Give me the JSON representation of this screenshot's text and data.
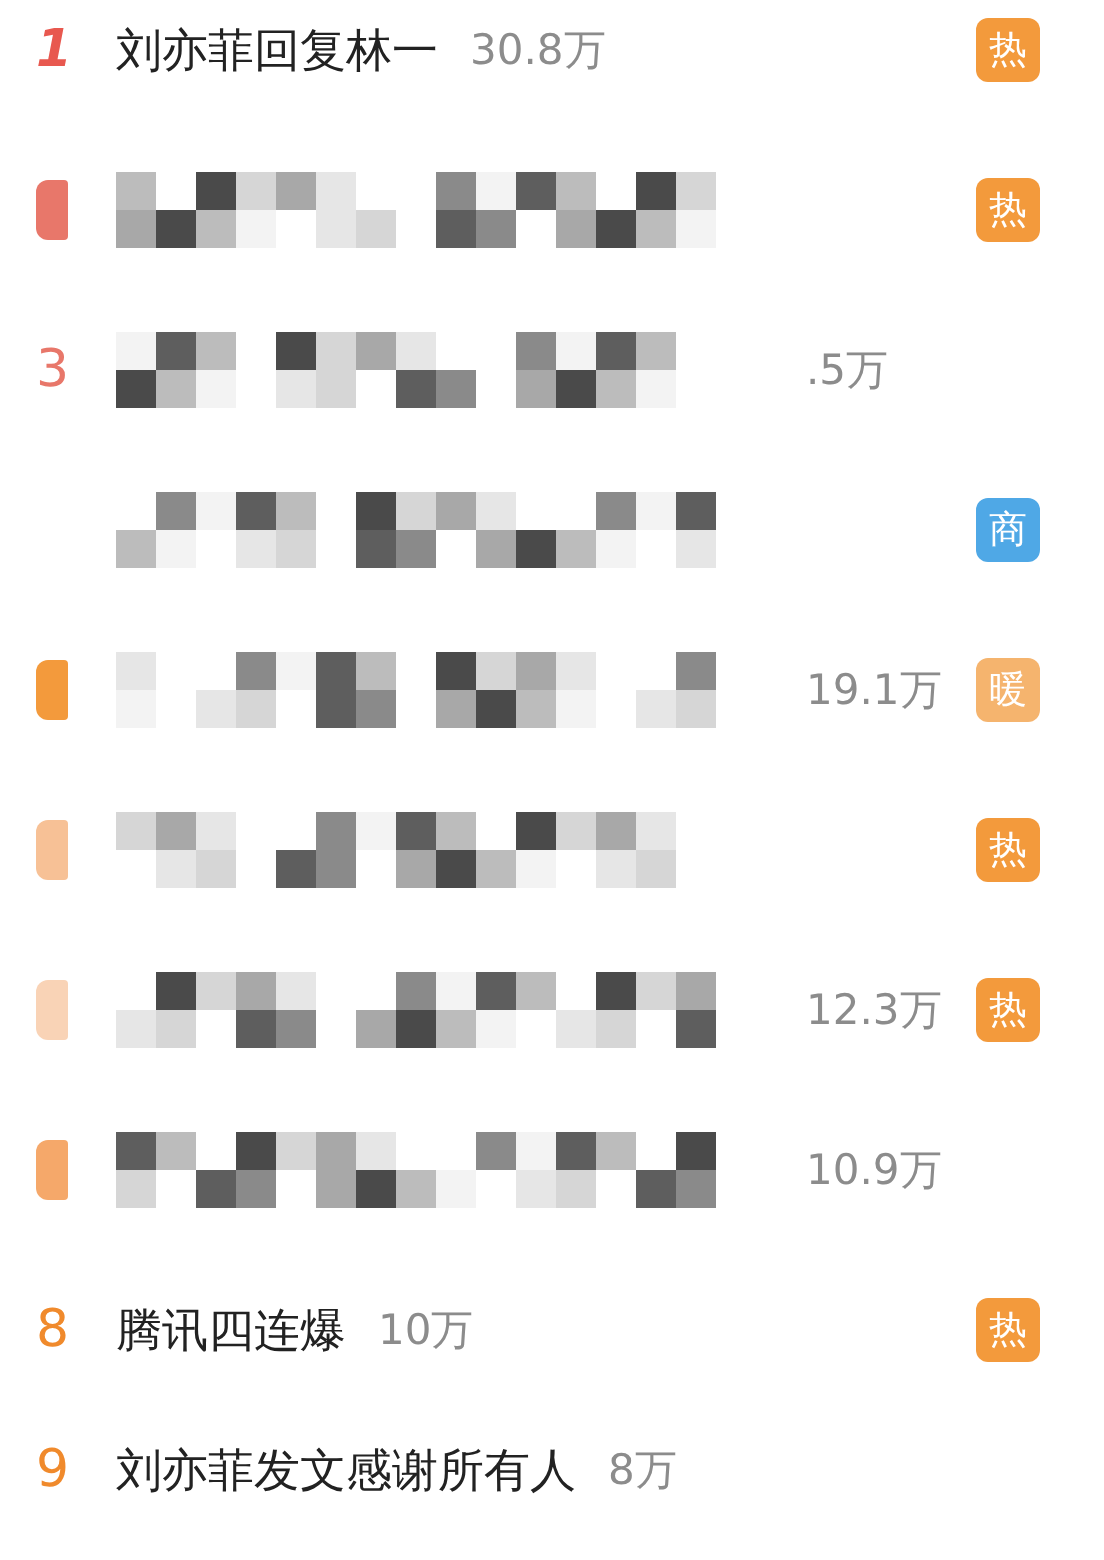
{
  "hot_list": [
    {
      "rank": "1",
      "color": "#e8584f",
      "title": "刘亦菲回复林一",
      "count": "30.8万",
      "badge": {
        "text": "热",
        "kind": "hot"
      }
    },
    {
      "color": "#e8776a",
      "mosaic": true,
      "badge": {
        "text": "热",
        "kind": "hot"
      }
    },
    {
      "rank": "3",
      "color": "#e8776a",
      "mosaic": true,
      "count": ".5万"
    },
    {
      "mosaic": true,
      "badge": {
        "text": "商",
        "kind": "ad"
      }
    },
    {
      "color": "#f39a3c",
      "mosaic": true,
      "count": "19.1万",
      "badge": {
        "text": "暖",
        "kind": "warm"
      }
    },
    {
      "color": "#f7c196",
      "mosaic": true,
      "badge": {
        "text": "热",
        "kind": "hot"
      }
    },
    {
      "color": "#f9d3b6",
      "mosaic": true,
      "count": "12.3万",
      "badge": {
        "text": "热",
        "kind": "hot"
      }
    },
    {
      "color": "#f5a86a",
      "mosaic": true,
      "count": "10.9万"
    },
    {
      "rank": "8",
      "color": "#f08a2c",
      "title": "腾讯四连爆",
      "count": "10万",
      "badge": {
        "text": "热",
        "kind": "hot"
      }
    },
    {
      "rank": "9",
      "color": "#f08a2c",
      "title": "刘亦菲发文感谢所有人",
      "count": "8万"
    }
  ]
}
